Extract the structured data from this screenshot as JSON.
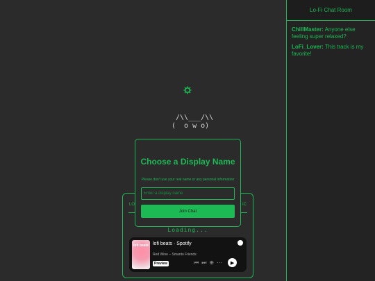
{
  "chat": {
    "title": "Lo-Fi Chat Room",
    "messages": [
      {
        "user": "ChillMaster:",
        "text": "Anyone else feeling super relaxed?"
      },
      {
        "user": "LoFi_Lover:",
        "text": "This track is my favorite!"
      }
    ]
  },
  "scene": {
    "ascii_art": " /\\\\___/\\\\\n(  o w o)",
    "ascii_faint": "/\\  /\\",
    "icon": "gear-icon"
  },
  "player_panel": {
    "left_label": "LO",
    "right_label": "IC",
    "loading_text": "Loading..."
  },
  "spotify": {
    "title": "lofi beats · Spotify",
    "subtitle": "Red Wine – Smanto Friends",
    "badge": "Preview",
    "art_text": "lofi beats"
  },
  "modal": {
    "title": "Choose a Display Name",
    "note": "Please don't use your real name or any personal information",
    "input_placeholder": "Enter a display name",
    "input_value": "",
    "button_label": "Join Chat"
  },
  "colors": {
    "accent": "#1db954",
    "background": "#2b2b2b",
    "sidebar": "#232323"
  }
}
